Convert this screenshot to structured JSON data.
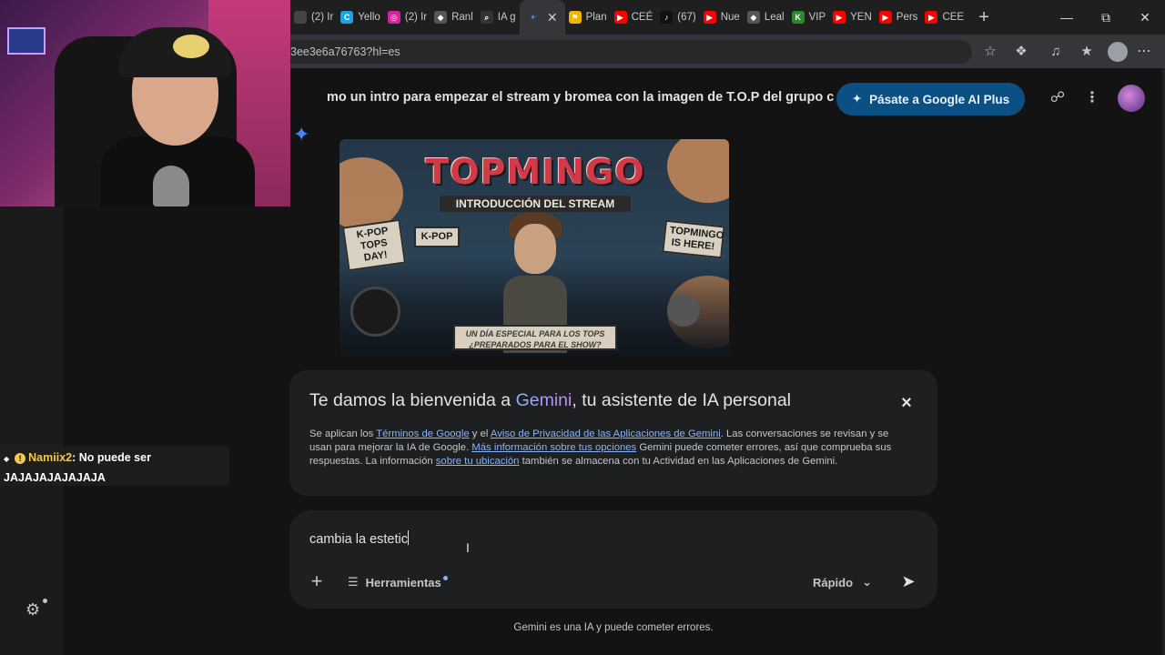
{
  "browser": {
    "tabs": [
      {
        "label": "(2) Ir",
        "icon": "generic",
        "color": "#444444"
      },
      {
        "label": "Yello",
        "icon": "canva",
        "color": "#1fa3e0"
      },
      {
        "label": "(2) Ir",
        "icon": "instagram",
        "color": "#d6249f"
      },
      {
        "label": "Ranl",
        "icon": "diamond",
        "color": "#555555"
      },
      {
        "label": "IA g",
        "icon": "search",
        "color": "#333333"
      },
      {
        "label": "",
        "icon": "gemini",
        "color": "#4285f4",
        "active": true
      },
      {
        "label": "Plan",
        "icon": "flag",
        "color": "#f2b400"
      },
      {
        "label": "CEÉ",
        "icon": "youtube",
        "color": "#ff0000"
      },
      {
        "label": "(67)",
        "icon": "tiktok",
        "color": "#111111"
      },
      {
        "label": "Nue",
        "icon": "youtube",
        "color": "#ff0000"
      },
      {
        "label": "Leal",
        "icon": "diamond",
        "color": "#555555"
      },
      {
        "label": "VIP",
        "icon": "k",
        "color": "#2a8a2a"
      },
      {
        "label": "YEN",
        "icon": "youtube",
        "color": "#ff0000"
      },
      {
        "label": "Pers",
        "icon": "youtube",
        "color": "#ff0000"
      },
      {
        "label": "CEE",
        "icon": "youtube",
        "color": "#ff0000"
      }
    ],
    "url": "3ee3e6a76763?hl=es"
  },
  "stream": {
    "chat_user": "Namiix2",
    "chat_message": ": No puede ser",
    "chat_message2": "JAJAJAJAJAJAJA"
  },
  "gemini": {
    "prompt_title": "mo un intro para empezar el stream y bromea con la imagen de T.O.P del grupo c",
    "upgrade_label": "Pásate a Google AI Plus",
    "image": {
      "title": "TOPMINGO",
      "subtitle": "INTRODUCCIÓN DEL STREAM",
      "sign_left1": "K-POP TOPS DAY!",
      "sign_left2": "K-POP",
      "sign_right": "TOPMINGO IS HERE!",
      "banner": "UN DÍA ESPECIAL PARA LOS TOPS ¿PREPARADOS PARA EL SHOW?"
    },
    "welcome": {
      "title_prefix": "Te damos la bienvenida a ",
      "title_brand": "Gemini",
      "title_suffix": ", tu asistente de IA personal",
      "body_1": "Se aplican los ",
      "link_terms": "Términos de Google",
      "body_2": " y el ",
      "link_privacy": "Aviso de Privacidad de las Aplicaciones de Gemini",
      "body_3": ". Las conversaciones se revisan y se usan para mejorar la IA de Google. ",
      "link_more": "Más información sobre tus opciones",
      "body_4": " Gemini puede cometer errores, así que comprueba sus respuestas. La información ",
      "link_location": "sobre tu ubicación",
      "body_5": " también se almacena con tu Actividad en las Aplicaciones de Gemini."
    },
    "input": {
      "value": "cambia la estetic",
      "tools_label": "Herramientas",
      "mode_label": "Rápido"
    },
    "disclaimer": "Gemini es una IA y puede cometer errores."
  },
  "colors": {
    "background": "#131314",
    "card": "#1e1f20",
    "upgrade": "#0b4f83",
    "link": "#8ab4f8"
  }
}
